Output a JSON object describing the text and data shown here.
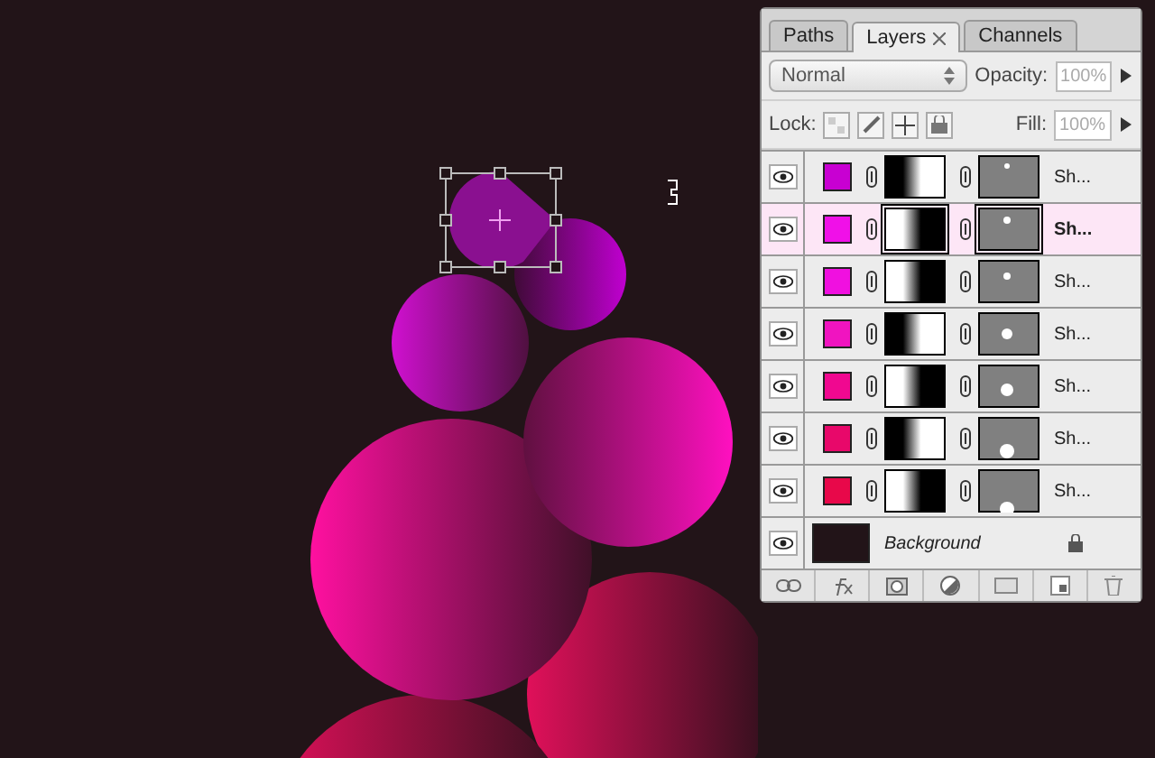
{
  "panel": {
    "tabs": [
      {
        "label": "Paths",
        "selected": false
      },
      {
        "label": "Layers",
        "selected": true
      },
      {
        "label": "Channels",
        "selected": false
      }
    ],
    "blend_mode": "Normal",
    "opacity_label": "Opacity:",
    "opacity": "100%",
    "lock_label": "Lock:",
    "fill_label": "Fill:",
    "fill": "100%",
    "layers": [
      {
        "kind": "shape",
        "name": "Sh...",
        "color": "#c800d2",
        "selected": false,
        "visible": true
      },
      {
        "kind": "shape",
        "name": "Sh...",
        "color": "#f010e8",
        "selected": true,
        "visible": true
      },
      {
        "kind": "shape",
        "name": "Sh...",
        "color": "#f010e0",
        "selected": false,
        "visible": true
      },
      {
        "kind": "shape",
        "name": "Sh...",
        "color": "#f014c0",
        "selected": false,
        "visible": true
      },
      {
        "kind": "shape",
        "name": "Sh...",
        "color": "#f00890",
        "selected": false,
        "visible": true
      },
      {
        "kind": "shape",
        "name": "Sh...",
        "color": "#e8086a",
        "selected": false,
        "visible": true
      },
      {
        "kind": "shape",
        "name": "Sh...",
        "color": "#e8084a",
        "selected": false,
        "visible": true
      },
      {
        "kind": "background",
        "name": "Background",
        "color": "#221418",
        "selected": false,
        "visible": true,
        "locked": true
      }
    ]
  }
}
